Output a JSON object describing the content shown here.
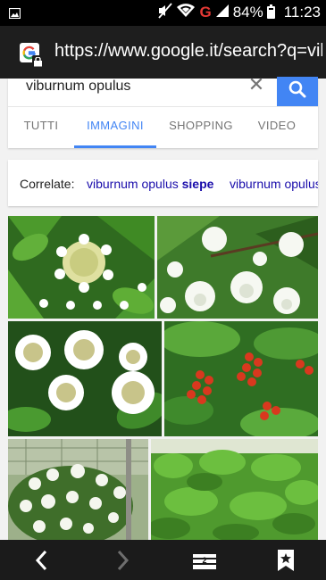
{
  "status_bar": {
    "network": "G",
    "battery_percent": "84%",
    "battery_level": 0.84,
    "time": "11:23",
    "icons": [
      "image-notification-icon",
      "mute-icon",
      "wifi-icon",
      "signal-icon",
      "battery-icon"
    ]
  },
  "browser": {
    "url": "https://www.google.it/search?q=viburnum+opulus"
  },
  "search": {
    "query": "viburnum opulus",
    "tabs": [
      {
        "label": "TUTTI",
        "active": false
      },
      {
        "label": "IMMAGINI",
        "active": true
      },
      {
        "label": "SHOPPING",
        "active": false
      },
      {
        "label": "VIDEO",
        "active": false
      }
    ]
  },
  "related": {
    "label": "Correlate:",
    "chips": [
      {
        "prefix": "viburnum opulus ",
        "bold": "siepe"
      },
      {
        "prefix": "viburnum opulus",
        "bold": ""
      }
    ]
  },
  "images": [
    {
      "subject": "viburnum-lacecap-white-flower"
    },
    {
      "subject": "viburnum-snowball-white-flowers"
    },
    {
      "subject": "viburnum-lacecap-flower-clusters"
    },
    {
      "subject": "viburnum-red-berries"
    },
    {
      "subject": "viburnum-snowball-bush"
    },
    {
      "subject": "viburnum-green-hedge"
    }
  ],
  "nav": {
    "icons": [
      "back-icon",
      "forward-icon",
      "tabs-icon",
      "bookmark-icon"
    ]
  },
  "colors": {
    "accent": "#4285f4",
    "link": "#1a0dab",
    "network_indicator": "#e53935"
  }
}
